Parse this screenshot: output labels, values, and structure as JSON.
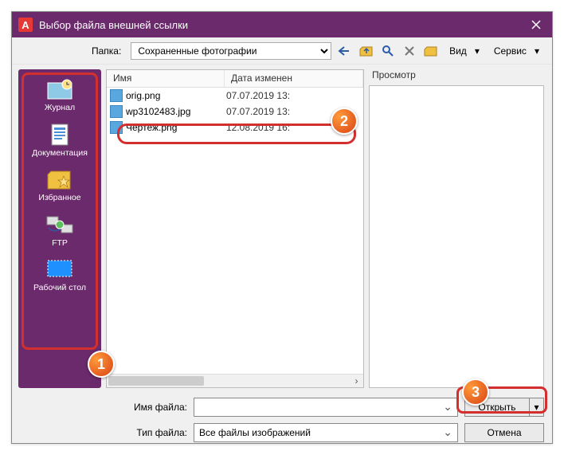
{
  "titlebar": {
    "title": "Выбор файла внешней ссылки"
  },
  "toolbar": {
    "folder_label": "Папка:",
    "folder_value": "Сохраненные фотографии",
    "view_label": "Вид",
    "tools_label": "Сервис"
  },
  "sidebar": [
    {
      "label": "Журнал",
      "icon": "history-icon"
    },
    {
      "label": "Документация",
      "icon": "document-icon"
    },
    {
      "label": "Избранное",
      "icon": "favorites-icon"
    },
    {
      "label": "FTP",
      "icon": "ftp-icon"
    },
    {
      "label": "Рабочий стол",
      "icon": "desktop-icon"
    }
  ],
  "filelist": {
    "columns": {
      "name": "Имя",
      "date": "Дата изменен"
    },
    "rows": [
      {
        "name": "orig.png",
        "date": "07.07.2019 13:"
      },
      {
        "name": "wp3102483.jpg",
        "date": "07.07.2019 13:"
      },
      {
        "name": "Чертеж.png",
        "date": "12.08.2019 16:"
      }
    ]
  },
  "preview": {
    "label": "Просмотр"
  },
  "footer": {
    "filename_label": "Имя файла:",
    "filename_value": "",
    "filetype_label": "Тип файла:",
    "filetype_value": "Все файлы изображений",
    "open_label": "Открыть",
    "cancel_label": "Отмена"
  },
  "badges": {
    "1": "1",
    "2": "2",
    "3": "3"
  }
}
